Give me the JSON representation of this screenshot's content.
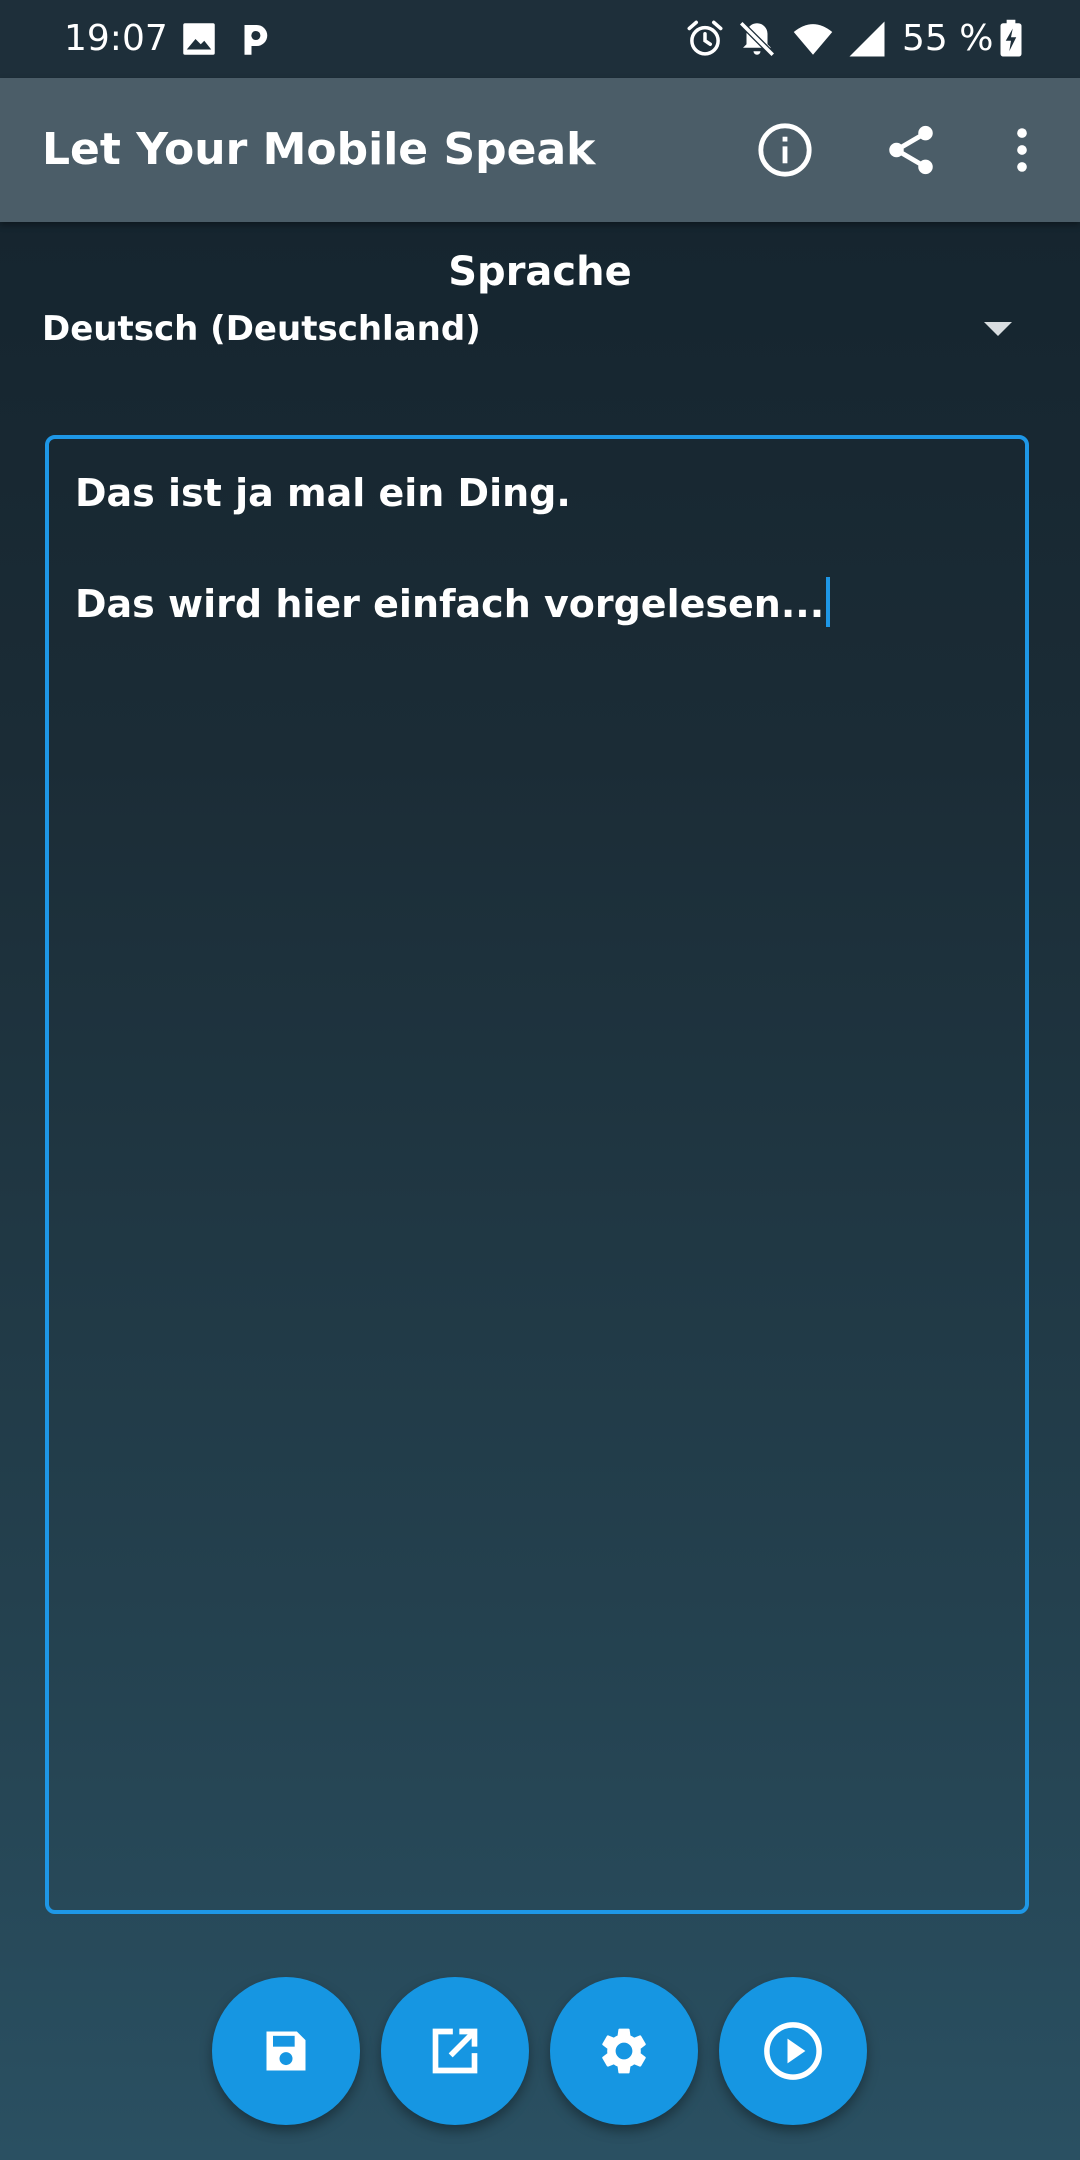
{
  "status_bar": {
    "time": "19:07",
    "battery_percent": "55 %",
    "icons": [
      "image-icon",
      "p-app-icon",
      "alarm-icon",
      "bell-off-icon",
      "wifi-icon",
      "signal-icon",
      "battery-icon"
    ]
  },
  "app_bar": {
    "title": "Let Your Mobile Speak",
    "actions": [
      "info-icon",
      "share-icon",
      "more-vert-icon"
    ]
  },
  "language": {
    "label": "Sprache",
    "selected": "Deutsch (Deutschland)"
  },
  "editor": {
    "lines": [
      "Das ist ja mal ein Ding.",
      "Das wird hier einfach vorgelesen..."
    ]
  },
  "actions": {
    "buttons": [
      "save-icon",
      "open-external-icon",
      "settings-icon",
      "play-icon"
    ]
  },
  "colors": {
    "accent": "#1696e2",
    "app_bar": "#4b5d68",
    "status_bar": "#1e2f3a"
  }
}
